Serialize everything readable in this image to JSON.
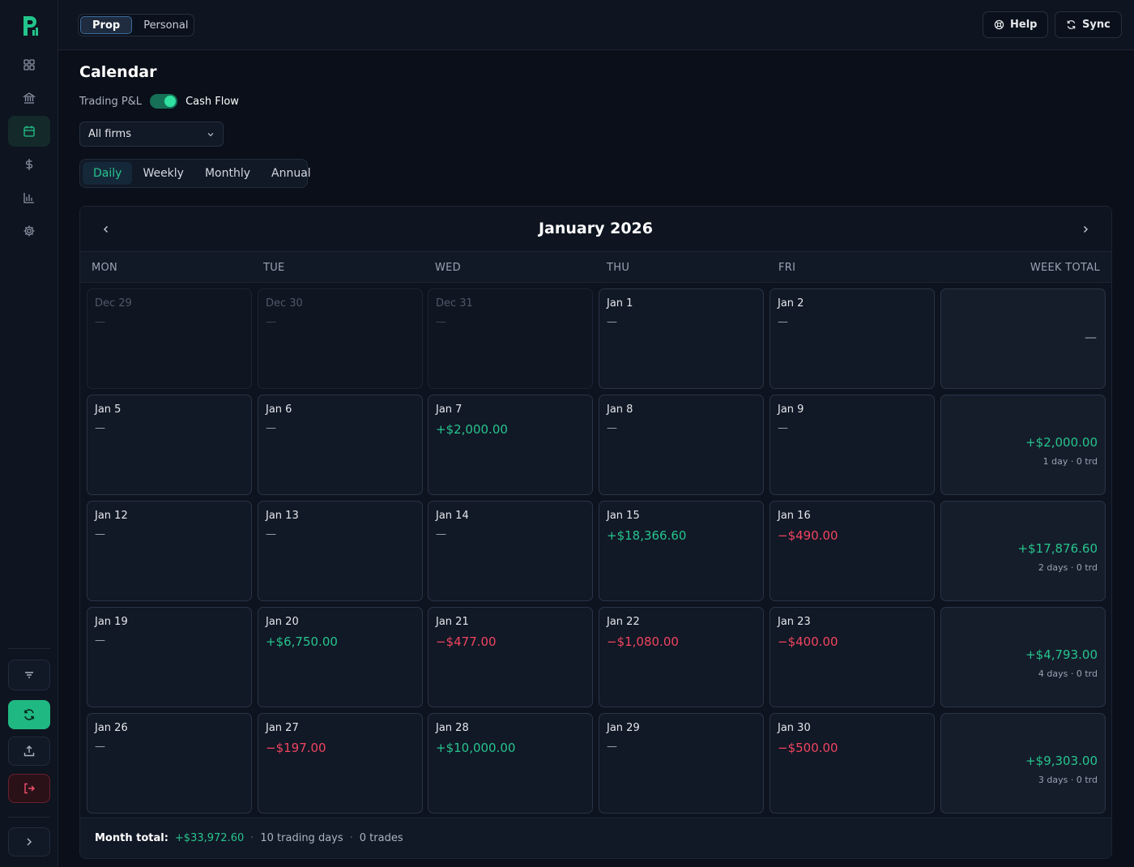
{
  "header": {
    "segments": [
      {
        "label": "Prop",
        "active": true
      },
      {
        "label": "Personal",
        "active": false
      }
    ],
    "help_label": "Help",
    "sync_label": "Sync"
  },
  "sidebar": {
    "items": [
      {
        "icon": "dashboard-icon",
        "active": false
      },
      {
        "icon": "bank-icon",
        "active": false
      },
      {
        "icon": "calendar-icon",
        "active": true
      },
      {
        "icon": "dollar-icon",
        "active": false
      },
      {
        "icon": "bar-chart-icon",
        "active": false
      },
      {
        "icon": "gear-icon",
        "active": false
      }
    ],
    "actions": [
      "filter-icon",
      "refresh-icon",
      "upload-icon",
      "logout-icon",
      "chevron-right-icon"
    ]
  },
  "page": {
    "title": "Calendar",
    "toggle_off_label": "Trading P&L",
    "toggle_on_label": "Cash Flow",
    "firm_select": "All firms",
    "view_tabs": [
      {
        "label": "Daily",
        "active": true
      },
      {
        "label": "Weekly",
        "active": false
      },
      {
        "label": "Monthly",
        "active": false
      },
      {
        "label": "Annual",
        "active": false
      }
    ]
  },
  "calendar": {
    "month_title": "January 2026",
    "columns": [
      "MON",
      "TUE",
      "WED",
      "THU",
      "FRI",
      "WEEK TOTAL"
    ],
    "weeks": [
      {
        "days": [
          {
            "label": "Dec 29",
            "value": "—",
            "kind": "none",
            "muted": true
          },
          {
            "label": "Dec 30",
            "value": "—",
            "kind": "none",
            "muted": true
          },
          {
            "label": "Dec 31",
            "value": "—",
            "kind": "none",
            "muted": true
          },
          {
            "label": "Jan 1",
            "value": "—",
            "kind": "none",
            "muted": false
          },
          {
            "label": "Jan 2",
            "value": "—",
            "kind": "none",
            "muted": false
          }
        ],
        "total": {
          "value": "—",
          "kind": "none",
          "sub": ""
        }
      },
      {
        "days": [
          {
            "label": "Jan 5",
            "value": "—",
            "kind": "none",
            "muted": false
          },
          {
            "label": "Jan 6",
            "value": "—",
            "kind": "none",
            "muted": false
          },
          {
            "label": "Jan 7",
            "value": "+$2,000.00",
            "kind": "pos",
            "muted": false
          },
          {
            "label": "Jan 8",
            "value": "—",
            "kind": "none",
            "muted": false
          },
          {
            "label": "Jan 9",
            "value": "—",
            "kind": "none",
            "muted": false
          }
        ],
        "total": {
          "value": "+$2,000.00",
          "kind": "pos",
          "sub": "1 day · 0 trd"
        }
      },
      {
        "days": [
          {
            "label": "Jan 12",
            "value": "—",
            "kind": "none",
            "muted": false
          },
          {
            "label": "Jan 13",
            "value": "—",
            "kind": "none",
            "muted": false
          },
          {
            "label": "Jan 14",
            "value": "—",
            "kind": "none",
            "muted": false
          },
          {
            "label": "Jan 15",
            "value": "+$18,366.60",
            "kind": "pos",
            "muted": false
          },
          {
            "label": "Jan 16",
            "value": "−$490.00",
            "kind": "neg",
            "muted": false
          }
        ],
        "total": {
          "value": "+$17,876.60",
          "kind": "pos",
          "sub": "2 days · 0 trd"
        }
      },
      {
        "days": [
          {
            "label": "Jan 19",
            "value": "—",
            "kind": "none",
            "muted": false
          },
          {
            "label": "Jan 20",
            "value": "+$6,750.00",
            "kind": "pos",
            "muted": false
          },
          {
            "label": "Jan 21",
            "value": "−$477.00",
            "kind": "neg",
            "muted": false
          },
          {
            "label": "Jan 22",
            "value": "−$1,080.00",
            "kind": "neg",
            "muted": false
          },
          {
            "label": "Jan 23",
            "value": "−$400.00",
            "kind": "neg",
            "muted": false
          }
        ],
        "total": {
          "value": "+$4,793.00",
          "kind": "pos",
          "sub": "4 days · 0 trd"
        }
      },
      {
        "days": [
          {
            "label": "Jan 26",
            "value": "—",
            "kind": "none",
            "muted": false
          },
          {
            "label": "Jan 27",
            "value": "−$197.00",
            "kind": "neg",
            "muted": false
          },
          {
            "label": "Jan 28",
            "value": "+$10,000.00",
            "kind": "pos",
            "muted": false
          },
          {
            "label": "Jan 29",
            "value": "—",
            "kind": "none",
            "muted": false
          },
          {
            "label": "Jan 30",
            "value": "−$500.00",
            "kind": "neg",
            "muted": false
          }
        ],
        "total": {
          "value": "+$9,303.00",
          "kind": "pos",
          "sub": "3 days · 0 trd"
        }
      }
    ],
    "footer": {
      "label": "Month total:",
      "amount": "+$33,972.60",
      "days": "10 trading days",
      "trades": "0 trades",
      "separator": "·"
    }
  },
  "colors": {
    "positive": "#27c48c",
    "negative": "#f0455f",
    "accent": "#20b882",
    "background": "#0a0f1a"
  }
}
